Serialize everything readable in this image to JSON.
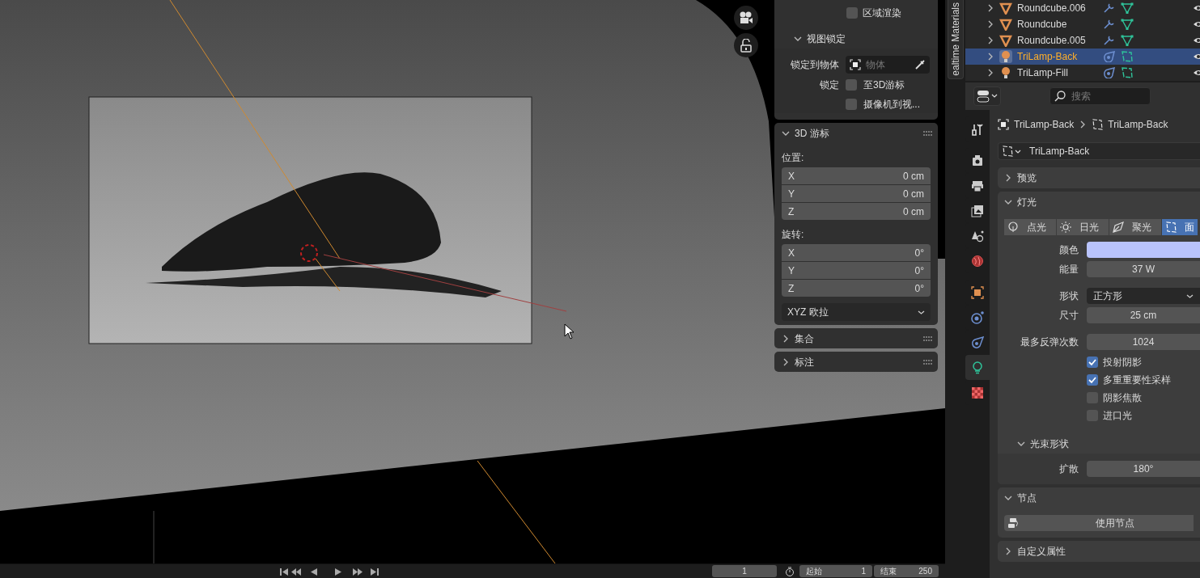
{
  "viewport": {
    "nav_buttons": [
      {
        "kind": "camera"
      },
      {
        "kind": "lock"
      }
    ]
  },
  "n_panel": {
    "view_section": {
      "region_render": {
        "label": "区域渲染",
        "checked": false
      },
      "view_lock": {
        "title": "视图锁定",
        "expanded": true,
        "lock_to_object": {
          "label": "锁定到物体",
          "placeholder": "物体"
        },
        "lock_label": "锁定",
        "options": [
          {
            "label": "至3D游标",
            "checked": false
          },
          {
            "label": "摄像机到视...",
            "checked": false
          }
        ]
      }
    },
    "panels": [
      {
        "kind": "cursor",
        "title": "3D 游标",
        "expanded": true,
        "location_label": "位置:",
        "location": [
          {
            "axis": "X",
            "value": "0 cm"
          },
          {
            "axis": "Y",
            "value": "0 cm"
          },
          {
            "axis": "Z",
            "value": "0 cm"
          }
        ],
        "rotation_label": "旋转:",
        "rotation": [
          {
            "axis": "X",
            "value": "0°"
          },
          {
            "axis": "Y",
            "value": "0°"
          },
          {
            "axis": "Z",
            "value": "0°"
          }
        ],
        "rotation_mode": "XYZ 欧拉"
      },
      {
        "kind": "collapsed",
        "title": "集合",
        "expanded": false
      },
      {
        "kind": "collapsed",
        "title": "标注",
        "expanded": false
      }
    ]
  },
  "sidebar_tab": {
    "label": "ealtime Materials"
  },
  "outliner": {
    "rows": [
      {
        "name": "Roundcube.006",
        "kind": "mesh",
        "selected": false
      },
      {
        "name": "Roundcube",
        "kind": "mesh",
        "selected": false
      },
      {
        "name": "Roundcube.005",
        "kind": "mesh",
        "selected": false
      },
      {
        "name": "TriLamp-Back",
        "kind": "light",
        "selected": true
      },
      {
        "name": "TriLamp-Fill",
        "kind": "light",
        "selected": false
      }
    ]
  },
  "properties": {
    "search": {
      "placeholder": "搜索"
    },
    "tabs": [
      {
        "kind": "tool",
        "selected": false
      },
      {
        "kind": "render",
        "selected": false
      },
      {
        "kind": "output",
        "selected": false
      },
      {
        "kind": "view_layer",
        "selected": false
      },
      {
        "kind": "scene",
        "selected": false
      },
      {
        "kind": "world",
        "selected": false
      },
      {
        "kind": "object",
        "selected": false
      },
      {
        "kind": "physics",
        "selected": false
      },
      {
        "kind": "constraints",
        "selected": false
      },
      {
        "kind": "light",
        "selected": true
      },
      {
        "kind": "texture",
        "selected": false
      }
    ],
    "breadcrumb": [
      {
        "kind": "object",
        "label": "TriLamp-Back"
      },
      {
        "kind": "light",
        "label": "TriLamp-Back"
      }
    ],
    "datablock": "TriLamp-Back",
    "panels": [
      {
        "kind": "collapsed",
        "title": "预览",
        "expanded": false
      },
      {
        "kind": "light",
        "title": "灯光",
        "expanded": true,
        "light_types": [
          {
            "kind": "point",
            "label": "点光",
            "selected": false
          },
          {
            "kind": "sun",
            "label": "日光",
            "selected": false
          },
          {
            "kind": "spot",
            "label": "聚光",
            "selected": false
          },
          {
            "kind": "area",
            "label": "面",
            "selected": true
          }
        ],
        "fields": [
          {
            "kind": "color",
            "label": "颜色",
            "color": "#b9c3fb"
          },
          {
            "kind": "number",
            "label": "能量",
            "value": "37 W"
          },
          {
            "kind": "gap"
          },
          {
            "kind": "dropdown",
            "label": "形状",
            "value": "正方形"
          },
          {
            "kind": "number",
            "label": "尺寸",
            "value": "25 cm"
          },
          {
            "kind": "gap"
          },
          {
            "kind": "number",
            "label": "最多反弹次数",
            "value": "1024"
          }
        ],
        "checkboxes": [
          {
            "label": "投射阴影",
            "checked": true
          },
          {
            "label": "多重重要性采样",
            "checked": true
          },
          {
            "label": "阴影焦散",
            "checked": false
          },
          {
            "label": "进口光",
            "checked": false
          }
        ],
        "subpanel": {
          "title": "光束形状",
          "expanded": true,
          "fields": [
            {
              "label": "扩散",
              "value": "180°"
            }
          ]
        }
      },
      {
        "kind": "nodes",
        "title": "节点",
        "expanded": true,
        "button": "使用节点"
      },
      {
        "kind": "collapsed",
        "title": "自定义属性",
        "expanded": false
      }
    ]
  },
  "timeline": {
    "current_frame": "1",
    "start_label": "起始",
    "start": "1",
    "end_label": "结束",
    "end": "250"
  }
}
